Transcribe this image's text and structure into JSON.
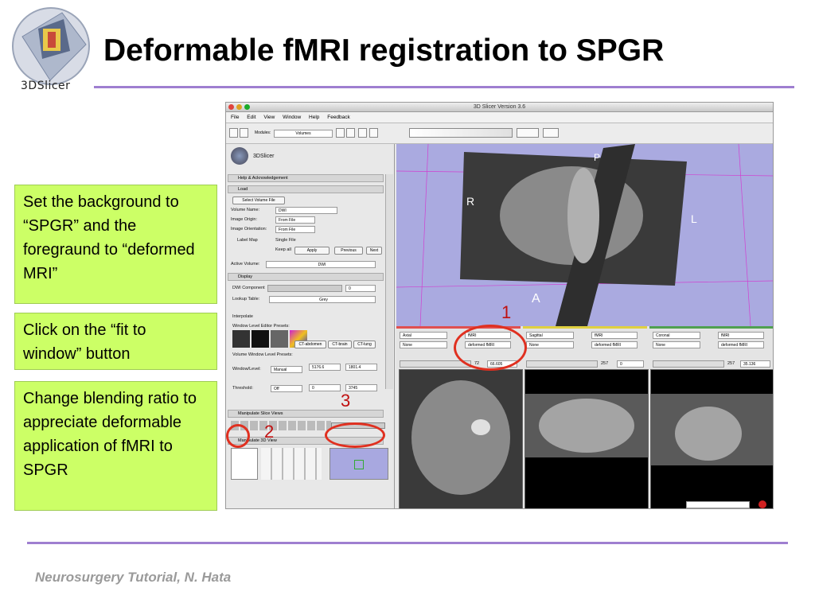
{
  "slide": {
    "title": "Deformable fMRI registration to SPGR",
    "logo_text": "3DSlicer",
    "footer": "Neurosurgery Tutorial, N. Hata"
  },
  "notes": [
    {
      "text": "Set the background to “SPGR” and the foregraund to “deformed MRI”"
    },
    {
      "text": "Click on the “fit to window” button"
    },
    {
      "text": "Change blending ratio to appreciate deformable application of fMRI to SPGR"
    }
  ],
  "callouts": [
    "1",
    "2",
    "3"
  ],
  "app": {
    "window_title": "3D Slicer Version 3.6",
    "menu": [
      "File",
      "Edit",
      "View",
      "Window",
      "Help",
      "Feedback"
    ],
    "modules_label": "Modules:",
    "module_selected": "Volumes",
    "logo_text": "3DSlicer",
    "help_section": "Help & Acknowledgement",
    "load_section": "Load",
    "select_volume_file": "Select Volume File",
    "volume_name_label": "Volume Name:",
    "volume_name_value": "DWI",
    "image_origin_label": "Image Origin:",
    "image_origin_value": "From File",
    "image_orientation_label": "Image Orientation:",
    "image_orientation_value": "From File",
    "label_map": "Label Map",
    "single_file": "Single File",
    "keep_all": "Keep all",
    "apply": "Apply",
    "previous": "Previous",
    "next": "Next",
    "active_volume_label": "Active Volume:",
    "active_volume_value": "DWI",
    "display_section": "Display",
    "dwi_component_label": "DWI Component",
    "dwi_component_value": "0",
    "lookup_table_label": "Lookup Table:",
    "lookup_table_value": "Grey",
    "interpolate": "Interpolate",
    "wl_presets_label": "Window Level Editor Presets:",
    "preset_buttons": [
      "CT-abdomen",
      "CT-brain",
      "CT-lung"
    ],
    "vwl_presets_label": "Volume Window Level Presets:",
    "window_level_label": "Window/Level:",
    "window_level_mode": "Manual",
    "window_value": "5176.6",
    "level_value": "1801.4",
    "threshold_label": "Threshold:",
    "threshold_mode": "Off",
    "threshold_low": "0",
    "threshold_high": "3745",
    "manipulate_slice": "Manipulate Slice Views",
    "manipulate_3d": "Manipulate 3D View",
    "orientation_labels": {
      "r": "R",
      "l": "L",
      "a": "A",
      "p": "P"
    },
    "views": [
      {
        "name": "Axial",
        "fg": "fMRI",
        "bg": "None",
        "lbl": "deformed fMRI",
        "color": "#e05050",
        "slice_num": "72",
        "slice_val": "66.605"
      },
      {
        "name": "Sagittal",
        "fg": "fMRI",
        "bg": "None",
        "lbl": "deformed fMRI",
        "color": "#e0d040",
        "slice_num": "257",
        "slice_val": "0"
      },
      {
        "name": "Coronal",
        "fg": "fMRI",
        "bg": "None",
        "lbl": "deformed fMRI",
        "color": "#50a050",
        "slice_num": "257",
        "slice_val": "35.136"
      }
    ]
  }
}
